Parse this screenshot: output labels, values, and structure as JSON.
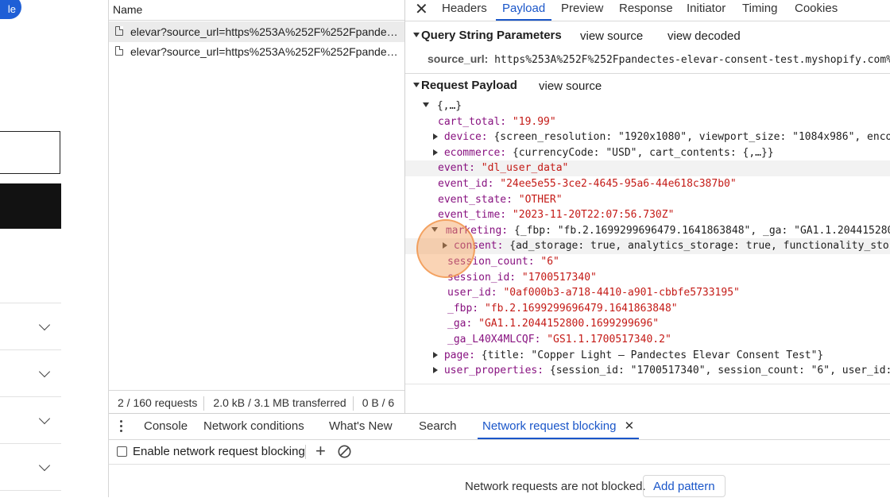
{
  "page": {
    "pill_label": "le"
  },
  "network": {
    "name_header": "Name",
    "requests": [
      "elevar?source_url=https%253A%252F%252Fpandectes-elevar-consent-test.myshopify.com",
      "elevar?source_url=https%253A%252F%252Fpandectes-elevar-consent-test.myshopify.com"
    ],
    "status": {
      "requests": "2 / 160 requests",
      "transferred": "2.0 kB / 3.1 MB transferred",
      "resources": "0 B / 6"
    }
  },
  "detail_tabs": [
    "Headers",
    "Payload",
    "Preview",
    "Response",
    "Initiator",
    "Timing",
    "Cookies"
  ],
  "active_detail_tab": "Payload",
  "query_string": {
    "title": "Query String Parameters",
    "view_source": "view source",
    "view_decoded": "view decoded",
    "param_key": "source_url:",
    "param_value": "https%253A%252F%252Fpandectes-elevar-consent-test.myshopify.com%2"
  },
  "request_payload": {
    "title": "Request Payload",
    "view_source": "view source",
    "root": "{,…}",
    "cart_total_k": "cart_total:",
    "cart_total_v": "\"19.99\"",
    "device_k": "device:",
    "device_v": "{screen_resolution: \"1920x1080\", viewport_size: \"1084x986\", encod",
    "ecommerce_k": "ecommerce:",
    "ecommerce_v": "{currencyCode: \"USD\", cart_contents: {,…}}",
    "event_k": "event:",
    "event_v": "\"dl_user_data\"",
    "event_id_k": "event_id:",
    "event_id_v": "\"24ee5e55-3ce2-4645-95a6-44e618c387b0\"",
    "event_state_k": "event_state:",
    "event_state_v": "\"OTHER\"",
    "event_time_k": "event_time:",
    "event_time_v": "\"2023-11-20T22:07:56.730Z\"",
    "marketing_k": "marketing:",
    "marketing_v": "{_fbp: \"fb.2.1699299696479.1641863848\", _ga: \"GA1.1.204415280",
    "consent_k": "consent:",
    "consent_v": "{ad_storage: true, analytics_storage: true, functionality_stor",
    "session_count_k": "session_count:",
    "session_count_v": "\"6\"",
    "session_id_k": "session_id:",
    "session_id_v": "\"1700517340\"",
    "user_id_k": "user_id:",
    "user_id_v": "\"0af000b3-a718-4410-a901-cbbfe5733195\"",
    "fbp_k": "_fbp:",
    "fbp_v": "\"fb.2.1699299696479.1641863848\"",
    "ga_k": "_ga:",
    "ga_v": "\"GA1.1.2044152800.1699299696\"",
    "ga_l40_k": "_ga_L40X4MLCQF:",
    "ga_l40_v": "\"GS1.1.1700517340.2\"",
    "page_k": "page:",
    "page_v": "{title: \"Copper Light – Pandectes Elevar Consent Test\"}",
    "user_props_k": "user_properties:",
    "user_props_v": "{session_id: \"1700517340\", session_count: \"6\", user_id: "
  },
  "drawer": {
    "tabs": [
      "Console",
      "Network conditions",
      "What's New",
      "Search",
      "Network request blocking"
    ],
    "active_tab": "Network request blocking",
    "enable_label": "Enable network request blocking",
    "not_blocked": "Network requests are not blocked.",
    "add_pattern": "Add pattern"
  },
  "colors": {
    "accent": "#1a56c9",
    "key": "#881280",
    "string": "#c41a16"
  }
}
